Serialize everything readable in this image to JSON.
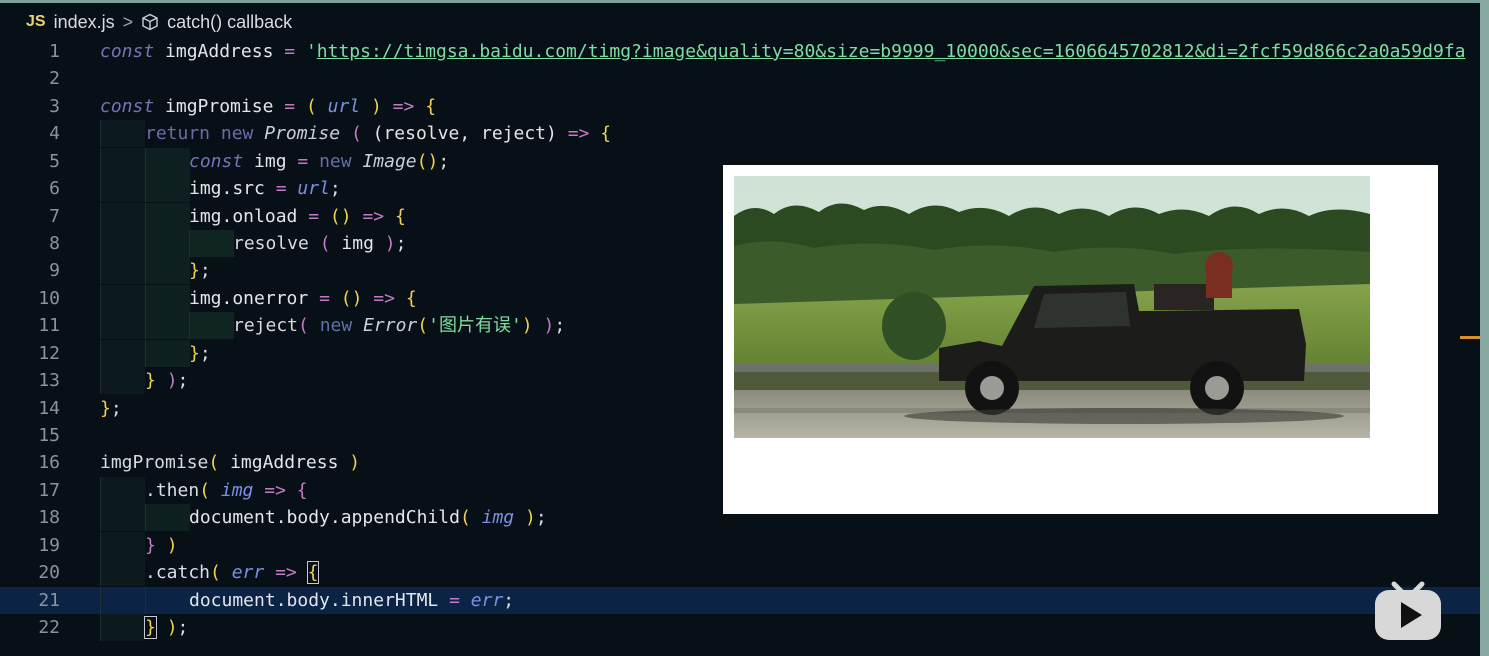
{
  "breadcrumb": {
    "file_icon": "JS",
    "file": "index.js",
    "separator": ">",
    "symbol_icon": "cube-icon",
    "symbol": "catch() callback"
  },
  "code_lines": [
    {
      "n": "1"
    },
    {
      "n": "2"
    },
    {
      "n": "3"
    },
    {
      "n": "4"
    },
    {
      "n": "5"
    },
    {
      "n": "6"
    },
    {
      "n": "7"
    },
    {
      "n": "8"
    },
    {
      "n": "9"
    },
    {
      "n": "10"
    },
    {
      "n": "11"
    },
    {
      "n": "12"
    },
    {
      "n": "13"
    },
    {
      "n": "14"
    },
    {
      "n": "15"
    },
    {
      "n": "16"
    },
    {
      "n": "17"
    },
    {
      "n": "18"
    },
    {
      "n": "19"
    },
    {
      "n": "20"
    },
    {
      "n": "21"
    },
    {
      "n": "22"
    }
  ],
  "code": {
    "l1_url": "https://timgsa.baidu.com/timg?image&quality=80&size=b9999_10000&sec=1606645702812&di=2fcf59d866c2a0a59d9fa",
    "l11_msg": "图片有误"
  },
  "preview": {
    "image_desc_icon": "truck-photo"
  },
  "colors": {
    "background": "#071017",
    "active_line": "#0b2345",
    "keyword": "#6f77b5",
    "string": "#7fdca2",
    "punctuation": "#f2d24f",
    "operator": "#c47bc6",
    "param": "#7b8fe3"
  }
}
